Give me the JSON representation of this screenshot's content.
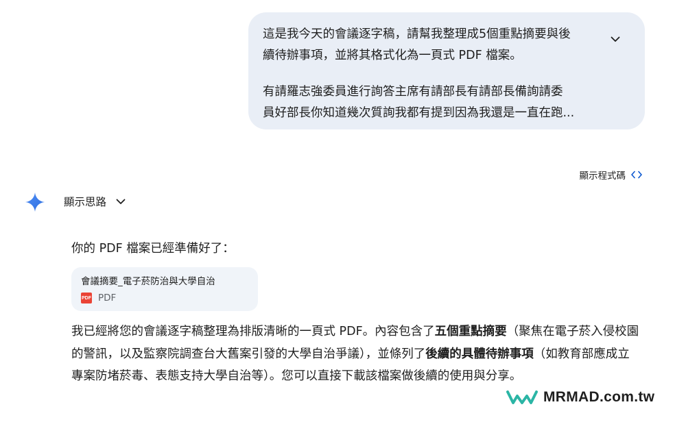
{
  "user_prompt": {
    "line1": "這是我今天的會議逐字稿，請幫我整理成5個重點摘要與後",
    "line2": "續待辦事項，並將其格式化為一頁式 PDF 檔案。",
    "line3": "有請羅志強委員進行詢答主席有請部長有請部長備詢請委",
    "line4": "員好部長你知道幾次質詢我都有提到因為我還是一直在跑..."
  },
  "show_code": {
    "label": "顯示程式碼",
    "icon": "code-icon"
  },
  "thinking": {
    "label": "顯示思路",
    "icon": "chevron-down-icon"
  },
  "response": {
    "ready_text": "你的 PDF 檔案已經準備好了：",
    "file": {
      "name": "會議摘要_電子菸防治與大學自治",
      "type": "PDF",
      "badge": "PDF"
    },
    "summary": {
      "part1": "我已經將您的會議逐字稿整理為排版清晰的一頁式 PDF。內容包含了",
      "bold1": "五個重點摘要",
      "part2": "（聚焦在電子菸入侵校園的警訊，以及監察院調查台大舊案引發的大學自治爭議），並條列了",
      "bold2": "後續的具體待辦事項",
      "part3": "（如教育部應成立專案防堵菸毒、表態支持大學自治等）。您可以直接下載該檔案做後續的使用與分享。"
    }
  },
  "watermark": {
    "text": "MRMAD.com.tw",
    "icon": "mrmad-logo-icon"
  },
  "colors": {
    "bubble": "#e9eef6",
    "file_card": "#f0f4f9",
    "accent": "#0b57d0",
    "pdf_red": "#ea4335"
  }
}
